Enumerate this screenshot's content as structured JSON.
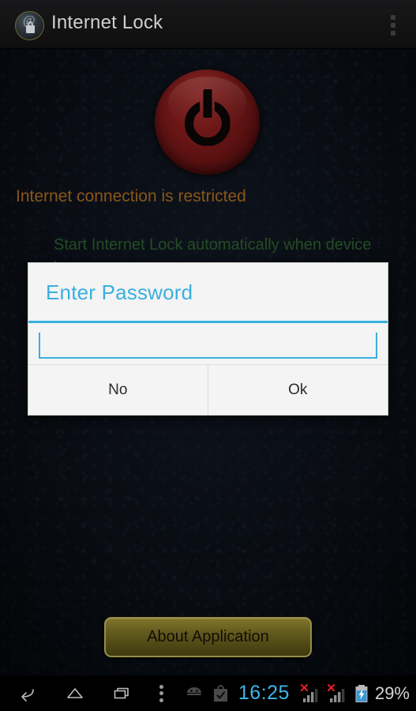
{
  "app": {
    "title": "Internet Lock",
    "icon": "globe-at-lock-icon",
    "overflow_icon": "overflow-menu-icon"
  },
  "main": {
    "power_button": {
      "name": "power-toggle-button",
      "color": "#7a1818",
      "glyph": "power-icon"
    },
    "status_text": "Internet connection is restricted",
    "status_color": "#a86a1e",
    "boot_option_text": "Start Internet Lock automatically when device boots",
    "boot_option_color": "#2b5e2c",
    "about_button": "About Application"
  },
  "dialog": {
    "title": "Enter Password",
    "title_color": "#3aafe0",
    "input": {
      "value": "",
      "placeholder": ""
    },
    "buttons": [
      {
        "label": "No",
        "name": "dialog-no-button"
      },
      {
        "label": "Ok",
        "name": "dialog-ok-button"
      }
    ]
  },
  "navbar": {
    "back_icon": "back-arrow-icon",
    "home_icon": "home-icon",
    "recents_icon": "recent-apps-icon",
    "menu_icon": "menu-dots-icon"
  },
  "statusbar": {
    "android_icon": "android-robot-icon",
    "store_icon": "play-store-bag-check-icon",
    "clock": "16:25",
    "clock_color": "#3ab6e8",
    "signal_icons": [
      "signal-bars-no-service-icon",
      "signal-bars-no-service-icon"
    ],
    "battery_icon": "battery-charging-icon",
    "battery_level": "29%"
  }
}
